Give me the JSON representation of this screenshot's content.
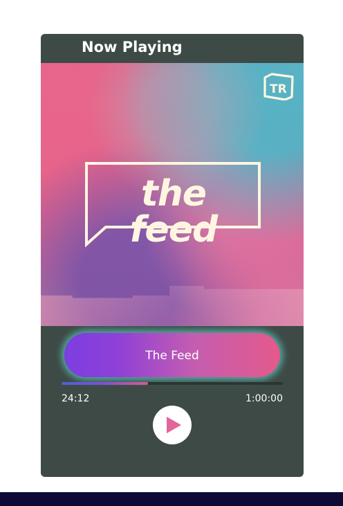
{
  "header": {
    "title": "Now Playing"
  },
  "artwork": {
    "show_title": "the feed",
    "logo_text": "TR",
    "logo_icon": "tr-logo-icon",
    "colors": {
      "pink": "#e35b84",
      "teal": "#4eb3c4",
      "purple": "#7f53a8",
      "cream": "#fff6e2"
    }
  },
  "track": {
    "title": "The Feed"
  },
  "progress": {
    "elapsed": "24:12",
    "duration": "1:00:00",
    "value": 0.39
  },
  "controls": {
    "play_icon": "play-icon",
    "accent": "#e3659a"
  },
  "theme": {
    "panel": "#3e4a45",
    "footer": "#0d0b36"
  }
}
